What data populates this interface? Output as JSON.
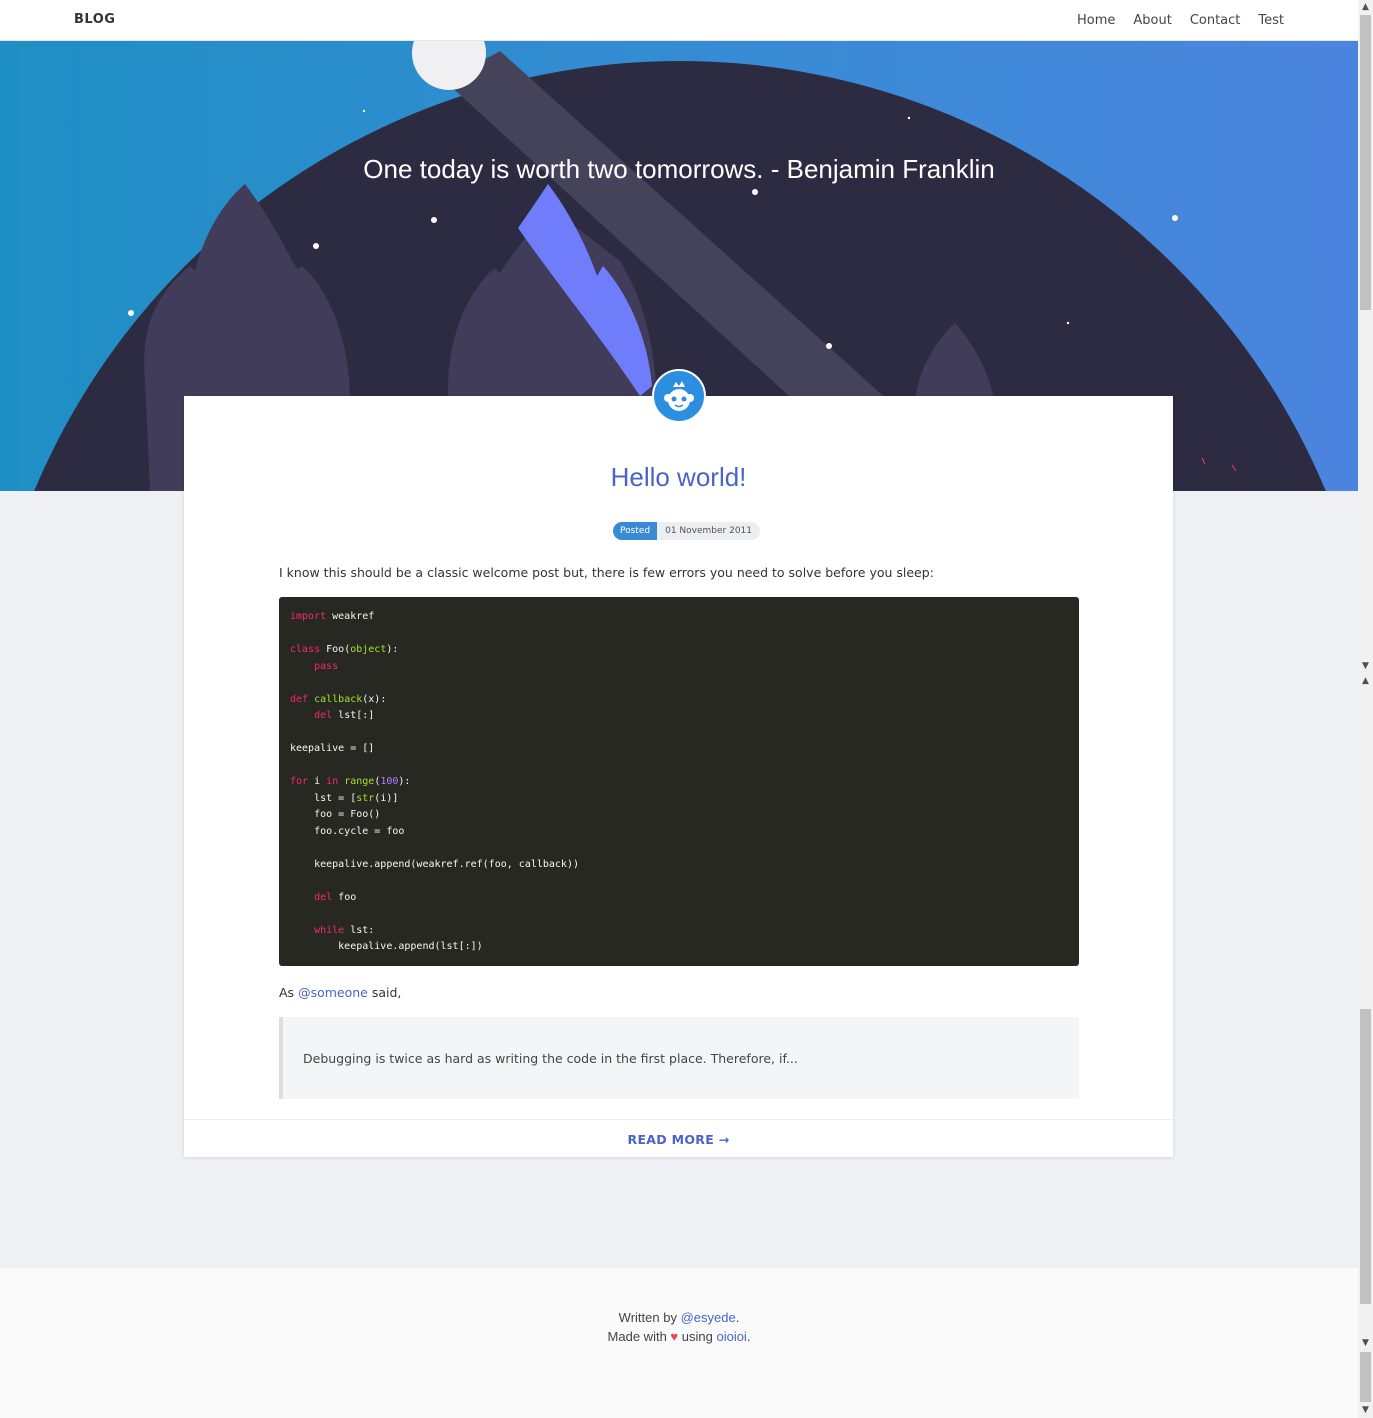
{
  "nav": {
    "brand": "BLOG",
    "links": [
      "Home",
      "About",
      "Contact",
      "Test"
    ]
  },
  "hero": {
    "quote": "One today is worth two tomorrows. - Benjamin Franklin"
  },
  "post": {
    "title": "Hello world!",
    "posted_label": "Posted",
    "date": "01 November 2011",
    "intro": "I know this should be a classic welcome post but, there is few errors you need to solve before you sleep:",
    "code_lines": [
      "import weakref",
      "",
      "class Foo(object):",
      "    pass",
      "",
      "def callback(x):",
      "    del lst[:]",
      "",
      "keepalive = []",
      "",
      "for i in range(100):",
      "    lst = [str(i)]",
      "    foo = Foo()",
      "    foo.cycle = foo",
      "",
      "    keepalive.append(weakref.ref(foo, callback))",
      "",
      "    del foo",
      "",
      "    while lst:",
      "        keepalive.append(lst[:])"
    ],
    "as_prefix": "As",
    "as_link": "@someone",
    "as_suffix": "said,",
    "blockquote": "Debugging is twice as hard as writing the code in the first place. Therefore, if...",
    "read_more": "READ MORE →"
  },
  "footer": {
    "written_by": "Written by",
    "author_link": "@esyede",
    "made_with": "Made with",
    "heart": "♥",
    "using": "using",
    "tool_link": "oioioi"
  },
  "colors": {
    "accent": "#4a63c8",
    "hero_bg": "#2d2b42",
    "rocket": "#6f7dfb",
    "badge": "#3a8bd6"
  }
}
